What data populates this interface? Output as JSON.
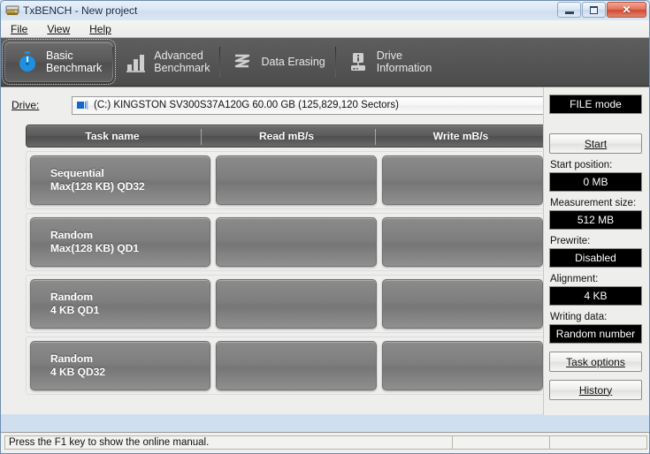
{
  "window": {
    "title": "TxBENCH - New project",
    "icon": "hard-drive-icon",
    "buttons": {
      "minimize": "minimize-icon",
      "maximize": "maximize-icon",
      "close": "✕"
    }
  },
  "menu": {
    "items": [
      {
        "label": "File",
        "accel": "F"
      },
      {
        "label": "View",
        "accel": "V"
      },
      {
        "label": "Help",
        "accel": "H"
      }
    ]
  },
  "tabs": [
    {
      "id": "basic-benchmark",
      "line1": "Basic",
      "line2": "Benchmark",
      "icon": "stopwatch-icon",
      "active": true
    },
    {
      "id": "advanced-benchmark",
      "line1": "Advanced",
      "line2": "Benchmark",
      "icon": "bar-chart-icon",
      "active": false
    },
    {
      "id": "data-erasing",
      "line1": "Data Erasing",
      "line2": "",
      "icon": "shred-icon",
      "active": false
    },
    {
      "id": "drive-information",
      "line1": "Drive",
      "line2": "Information",
      "icon": "drive-info-icon",
      "active": false
    }
  ],
  "drive": {
    "label": "Drive:",
    "accel": "D",
    "value": "(C:) KINGSTON SV300S37A120G  60.00 GB (125,829,120 Sectors)",
    "icon": "drive-small-icon",
    "refresh_icon": "refresh-icon"
  },
  "table": {
    "headers": [
      "Task name",
      "Read mB/s",
      "Write mB/s"
    ],
    "rows": [
      {
        "name_line1": "Sequential",
        "name_line2": "Max(128 KB) QD32",
        "read": "",
        "write": ""
      },
      {
        "name_line1": "Random",
        "name_line2": "Max(128 KB) QD1",
        "read": "",
        "write": ""
      },
      {
        "name_line1": "Random",
        "name_line2": "4 KB QD1",
        "read": "",
        "write": ""
      },
      {
        "name_line1": "Random",
        "name_line2": "4 KB QD32",
        "read": "",
        "write": ""
      }
    ]
  },
  "sidebar": {
    "mode": "FILE mode",
    "start_button": "Start",
    "start_button_accel": "S",
    "fields": [
      {
        "label": "Start position:",
        "value": "0 MB"
      },
      {
        "label": "Measurement size:",
        "value": "512 MB"
      },
      {
        "label": "Prewrite:",
        "value": "Disabled"
      },
      {
        "label": "Alignment:",
        "value": "4 KB"
      },
      {
        "label": "Writing data:",
        "value": "Random number"
      }
    ],
    "task_options_button": "Task options",
    "task_options_accel": "T",
    "history_button": "History",
    "history_accel": "i"
  },
  "status": {
    "message": "Press the F1 key to show the online manual.",
    "panel2": "",
    "panel3": ""
  },
  "colors": {
    "accent_blue": "#1f8fe0",
    "tabstrip_bg": "#555555",
    "content_bg": "#eeeeec",
    "field_bg": "#000000",
    "close_red": "#cf4a32"
  }
}
